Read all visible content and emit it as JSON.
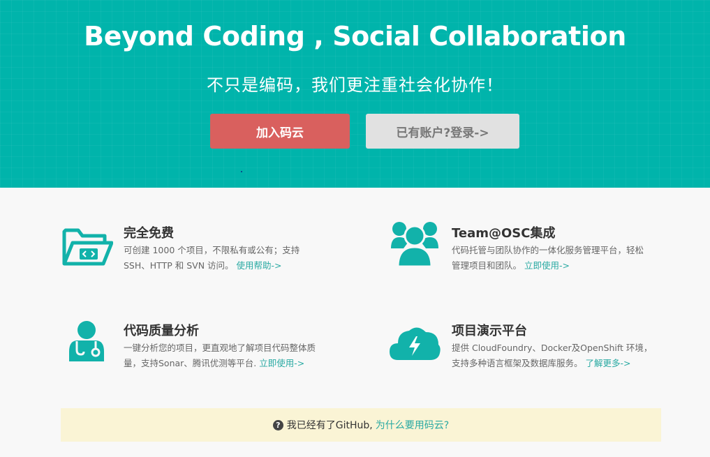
{
  "hero": {
    "title": "Beyond Coding , Social Collaboration",
    "subtitle": "不只是编码，我们更注重社会化协作！",
    "join_button": "加入码云",
    "login_button": "已有账户?登录->"
  },
  "features": [
    {
      "icon": "folder-code-icon",
      "title": "完全免费",
      "desc_line1": "可创建 1000 个项目，不限私有或公有；支持",
      "desc_line2": "SSH、HTTP 和 SVN 访问。",
      "link": "使用帮助->"
    },
    {
      "icon": "team-group-icon",
      "title": "Team@OSC集成",
      "desc_line1": "代码托管与团队协作的一体化服务管理平台，轻松",
      "desc_line2": "管理项目和团队。",
      "link": "立即使用->"
    },
    {
      "icon": "doctor-stethoscope-icon",
      "title": "代码质量分析",
      "desc_line1": "一键分析您的项目，更直观地了解项目代码整体质",
      "desc_line2": "量，支持Sonar、腾讯优测等平台.",
      "link": "立即使用->"
    },
    {
      "icon": "cloud-lightning-icon",
      "title": "项目演示平台",
      "desc_line1": "提供 CloudFoundry、Docker及OpenShift 环境，",
      "desc_line2": "支持多种语言框架及数据库服务。",
      "link": "了解更多->"
    }
  ],
  "notice": {
    "icon": "question-circle-icon",
    "text": "我已经有了GitHub,",
    "link": "为什么要用码云?"
  },
  "colors": {
    "brand_teal": "#00b4ab",
    "join_red": "#d9605e",
    "link": "#28a9a2",
    "notice_bg": "#faf4d5"
  }
}
